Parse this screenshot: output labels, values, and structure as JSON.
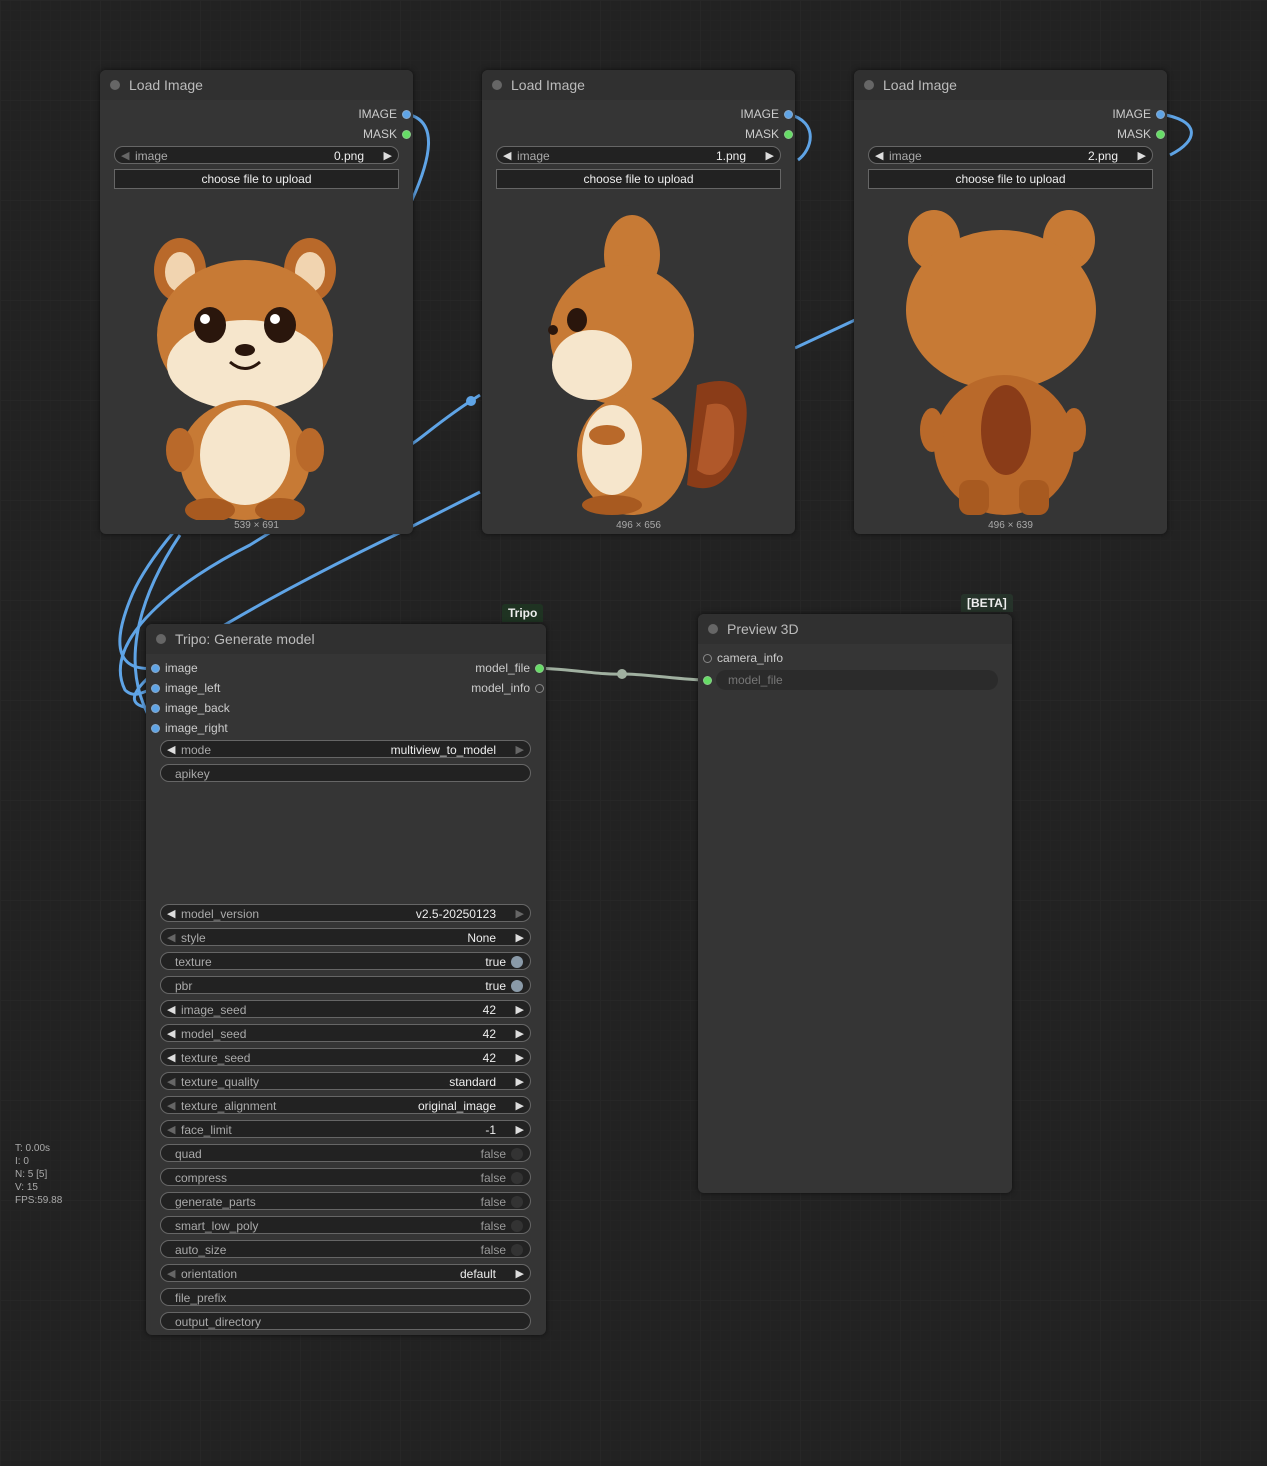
{
  "load_nodes": [
    {
      "title": "Load Image",
      "out_image": "IMAGE",
      "out_mask": "MASK",
      "widget_name": "image",
      "widget_value": "0.png",
      "upload_label": "choose file to upload",
      "dimensions": "539 × 691"
    },
    {
      "title": "Load Image",
      "out_image": "IMAGE",
      "out_mask": "MASK",
      "widget_name": "image",
      "widget_value": "1.png",
      "upload_label": "choose file to upload",
      "dimensions": "496 × 656"
    },
    {
      "title": "Load Image",
      "out_image": "IMAGE",
      "out_mask": "MASK",
      "widget_name": "image",
      "widget_value": "2.png",
      "upload_label": "choose file to upload",
      "dimensions": "496 × 639"
    }
  ],
  "tripo": {
    "tag": "Tripo",
    "title": "Tripo: Generate model",
    "inputs": [
      "image",
      "image_left",
      "image_back",
      "image_right"
    ],
    "outputs": [
      "model_file",
      "model_info"
    ],
    "mode": {
      "name": "mode",
      "value": "multiview_to_model"
    },
    "apikey": "apikey",
    "widgets": [
      {
        "name": "model_version",
        "value": "v2.5-20250123"
      },
      {
        "name": "style",
        "value": "None"
      },
      {
        "name": "texture",
        "value": "true"
      },
      {
        "name": "pbr",
        "value": "true"
      },
      {
        "name": "image_seed",
        "value": "42"
      },
      {
        "name": "model_seed",
        "value": "42"
      },
      {
        "name": "texture_seed",
        "value": "42"
      },
      {
        "name": "texture_quality",
        "value": "standard"
      },
      {
        "name": "texture_alignment",
        "value": "original_image"
      },
      {
        "name": "face_limit",
        "value": "-1"
      },
      {
        "name": "quad",
        "value": "false"
      },
      {
        "name": "compress",
        "value": "false"
      },
      {
        "name": "generate_parts",
        "value": "false"
      },
      {
        "name": "smart_low_poly",
        "value": "false"
      },
      {
        "name": "auto_size",
        "value": "false"
      },
      {
        "name": "orientation",
        "value": "default"
      },
      {
        "name": "file_prefix",
        "value": ""
      },
      {
        "name": "output_directory",
        "value": ""
      }
    ]
  },
  "preview": {
    "tag": "[BETA]",
    "title": "Preview 3D",
    "input_camera": "camera_info",
    "input_model": "model_file"
  },
  "stats": {
    "t": "T: 0.00s",
    "i": "I: 0",
    "n": "N: 5 [5]",
    "v": "V: 15",
    "fps": "FPS:59.88"
  },
  "colors": {
    "link_image": "#5fa4e6",
    "link_model": "#a0b0a0",
    "node_bg": "#353535",
    "canvas_bg": "#222222"
  }
}
